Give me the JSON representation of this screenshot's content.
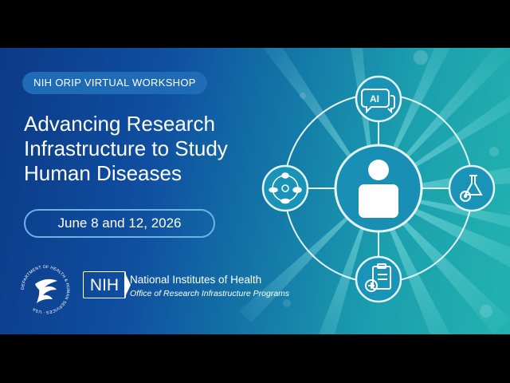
{
  "banner": {
    "eyebrow": "NIH ORIP VIRTUAL WORKSHOP",
    "title_lines": [
      "Advancing Research",
      "Infrastructure to Study",
      "Human Diseases"
    ],
    "dates": "June 8 and 12, 2026"
  },
  "logos": {
    "hhs_seal_text": "DEPARTMENT OF HEALTH & HUMAN SERVICES · USA",
    "nih_mark": "NIH",
    "org_name": "National Institutes of Health",
    "office_name": "Office of Research Infrastructure Programs"
  },
  "diagram": {
    "top_icon_text": "AI",
    "center_icon": "person-icon",
    "right_icon": "flask-gear-icon",
    "bottom_icon": "clipboard-plus-icon",
    "left_icon": "model-organism-cycle-icon"
  },
  "colors": {
    "background_start": "#0c3a86",
    "background_end": "#22b2b0",
    "node_fill": "#1a93b8",
    "accent_border": "#6fb3e6"
  }
}
